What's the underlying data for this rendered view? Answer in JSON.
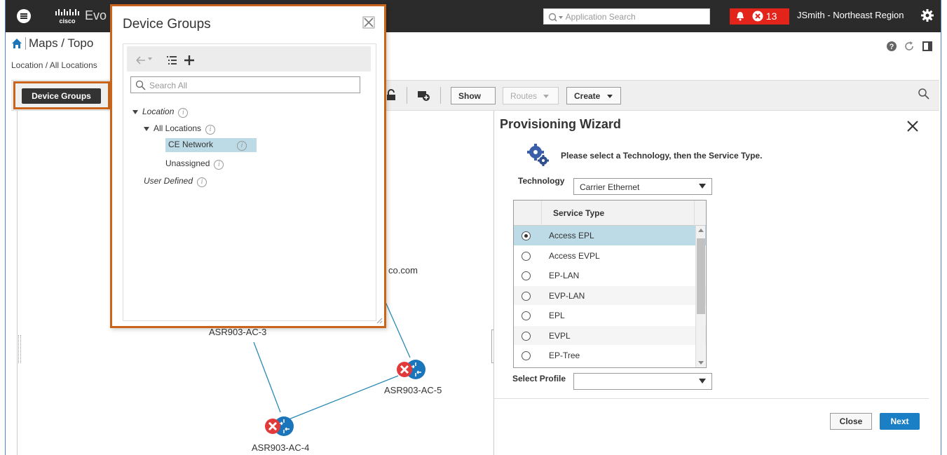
{
  "topbar": {
    "app_name": "Evo",
    "search_placeholder": "Application Search",
    "alarm_count": "13",
    "user_region": "JSmith - Northeast Region"
  },
  "header": {
    "page_title": "Maps / Topo",
    "breadcrumb": "Location / All Locations"
  },
  "toolbar": {
    "device_groups_label": "Device Groups",
    "show_label": "Show",
    "routes_label": "Routes",
    "create_label": "Create"
  },
  "map": {
    "devices": [
      {
        "label": "ASR903-AC-3"
      },
      {
        "label": "ASR903-AC-5"
      },
      {
        "label": "ASR903-AC-4"
      }
    ],
    "partial_label": "co.com"
  },
  "device_groups_popup": {
    "title": "Device Groups",
    "search_placeholder": "Search All",
    "tree": {
      "location": "Location",
      "all_locations": "All Locations",
      "ce_network": "CE Network",
      "unassigned": "Unassigned",
      "user_defined": "User Defined"
    }
  },
  "wizard": {
    "title": "Provisioning Wizard",
    "instruction": "Please select a Technology, then the Service Type.",
    "technology_label": "Technology",
    "technology_value": "Carrier Ethernet",
    "service_type_header": "Service Type",
    "service_types": [
      "Access EPL",
      "Access EVPL",
      "EP-LAN",
      "EVP-LAN",
      "EPL",
      "EVPL",
      "EP-Tree"
    ],
    "selected_service_type": "Access EPL",
    "select_profile_label": "Select Profile",
    "profile_value": "",
    "close_label": "Close",
    "next_label": "Next"
  },
  "colors": {
    "topbar_bg": "#2b2b2b",
    "alarm_red": "#e3241b",
    "highlight_orange": "#c8651b",
    "selection_blue": "#bddbe6",
    "primary_button": "#1a7fc4",
    "device_blue": "#1b75bb",
    "error_red": "#e03a3a"
  },
  "icons": [
    "menu-icon",
    "cisco-logo",
    "search-icon",
    "bell-icon",
    "error-icon",
    "gear-icon",
    "home-icon",
    "help-icon",
    "refresh-icon",
    "panel-icon",
    "close-icon",
    "back-arrow-icon",
    "list-icon",
    "plus-icon",
    "info-icon",
    "router-icon"
  ]
}
